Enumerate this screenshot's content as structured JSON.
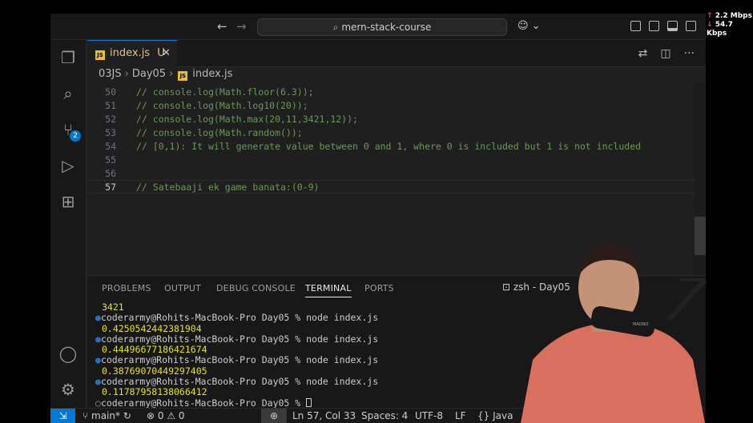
{
  "titlebar": {
    "back_icon": "arrow-left-icon",
    "forward_icon": "arrow-right-icon",
    "search_text": "mern-stack-course",
    "copilot_icon": "copilot-icon"
  },
  "activity": {
    "items": [
      "explorer-icon",
      "search-icon",
      "source-control-icon",
      "run-debug-icon",
      "extensions-icon",
      "account-icon",
      "settings-icon"
    ],
    "scm_badge": "2"
  },
  "tab": {
    "name": "index.js",
    "status": "U",
    "close": "✕",
    "icon_text": "JS"
  },
  "breadcrumb": {
    "parts": [
      "03JS",
      "Day05",
      "index.js"
    ]
  },
  "editor": {
    "lines": [
      {
        "num": "50",
        "text": "// console.log(Math.floor(6.3));"
      },
      {
        "num": "51",
        "text": "// console.log(Math.log10(20));"
      },
      {
        "num": "52",
        "text": "// console.log(Math.max(20,11,3421,12));"
      },
      {
        "num": "53",
        "text": "// console.log(Math.random());"
      },
      {
        "num": "54",
        "text": "// [0,1): It will generate value between 0 and 1, where 0 is included but 1 is not included"
      },
      {
        "num": "55",
        "text": ""
      },
      {
        "num": "56",
        "text": ""
      },
      {
        "num": "57",
        "text": "// Satebaaji ek game banata:(0-9)"
      }
    ]
  },
  "panel": {
    "tabs": [
      "PROBLEMS",
      "OUTPUT",
      "DEBUG CONSOLE",
      "TERMINAL",
      "PORTS"
    ],
    "active_tab": "TERMINAL",
    "shell_label": "zsh - Day05",
    "more": "···",
    "terminal": [
      {
        "type": "out",
        "text": "3421"
      },
      {
        "type": "cmd",
        "text": "coderarmy@Rohits-MacBook-Pro Day05 % node index.js"
      },
      {
        "type": "out",
        "text": "0.4250542442381904"
      },
      {
        "type": "cmd",
        "text": "coderarmy@Rohits-MacBook-Pro Day05 % node index.js"
      },
      {
        "type": "out",
        "text": "0.44496677186421674"
      },
      {
        "type": "cmd",
        "text": "coderarmy@Rohits-MacBook-Pro Day05 % node index.js"
      },
      {
        "type": "out",
        "text": "0.38769070449297405"
      },
      {
        "type": "cmd",
        "text": "coderarmy@Rohits-MacBook-Pro Day05 % node index.js"
      },
      {
        "type": "out",
        "text": "0.1178795813806641​2"
      },
      {
        "type": "prompt",
        "text": "coderarmy@Rohits-MacBook-Pro Day05 % "
      }
    ]
  },
  "status": {
    "branch": "main*",
    "errors": "0",
    "warnings": "0",
    "cursor": "Ln 57, Col 33",
    "spaces": "Spaces: 4",
    "encoding": "UTF-8",
    "eol": "LF",
    "language": "Java"
  },
  "network": {
    "up": "2.2 Mbps",
    "down": "54.7 Kbps"
  },
  "colors": {
    "accent": "#0078d4",
    "comment": "#6a9955",
    "terminal_output": "#e5e510"
  }
}
